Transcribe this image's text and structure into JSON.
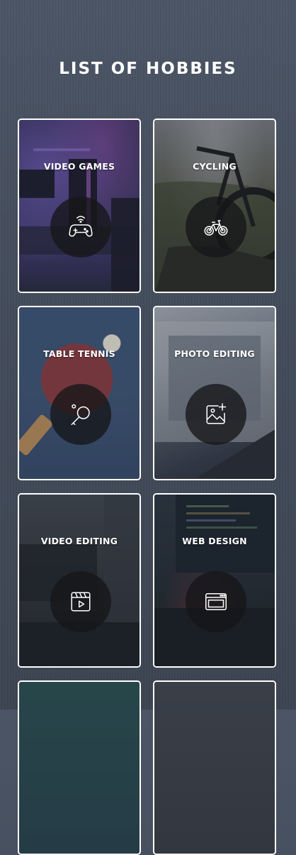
{
  "page": {
    "title": "LIST OF HOBBIES"
  },
  "hobbies": [
    {
      "label": "VIDEO GAMES",
      "icon": "gamepad-icon"
    },
    {
      "label": "CYCLING",
      "icon": "bicycle-icon"
    },
    {
      "label": "TABLE TENNIS",
      "icon": "ping-pong-icon"
    },
    {
      "label": "PHOTO EDITING",
      "icon": "image-add-icon"
    },
    {
      "label": "VIDEO EDITING",
      "icon": "video-clapper-icon"
    },
    {
      "label": "WEB DESIGN",
      "icon": "browser-window-icon"
    }
  ],
  "colors": {
    "background": "#454e5d",
    "text": "#ffffff",
    "card_border": "#ffffff",
    "icon_circle": "#161618"
  }
}
